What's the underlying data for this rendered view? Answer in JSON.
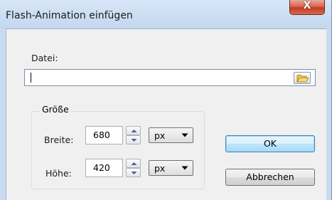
{
  "window": {
    "title": "Flash-Animation einfügen",
    "close_glyph": "X"
  },
  "file": {
    "label": "Datei:",
    "value": "",
    "browse_icon": "folder-open-icon"
  },
  "size_group": {
    "title": "Größe",
    "width": {
      "label": "Breite:",
      "value": "680",
      "unit": "px"
    },
    "height": {
      "label": "Höhe:",
      "value": "420",
      "unit": "px"
    }
  },
  "buttons": {
    "ok": "OK",
    "cancel": "Abbrechen"
  }
}
